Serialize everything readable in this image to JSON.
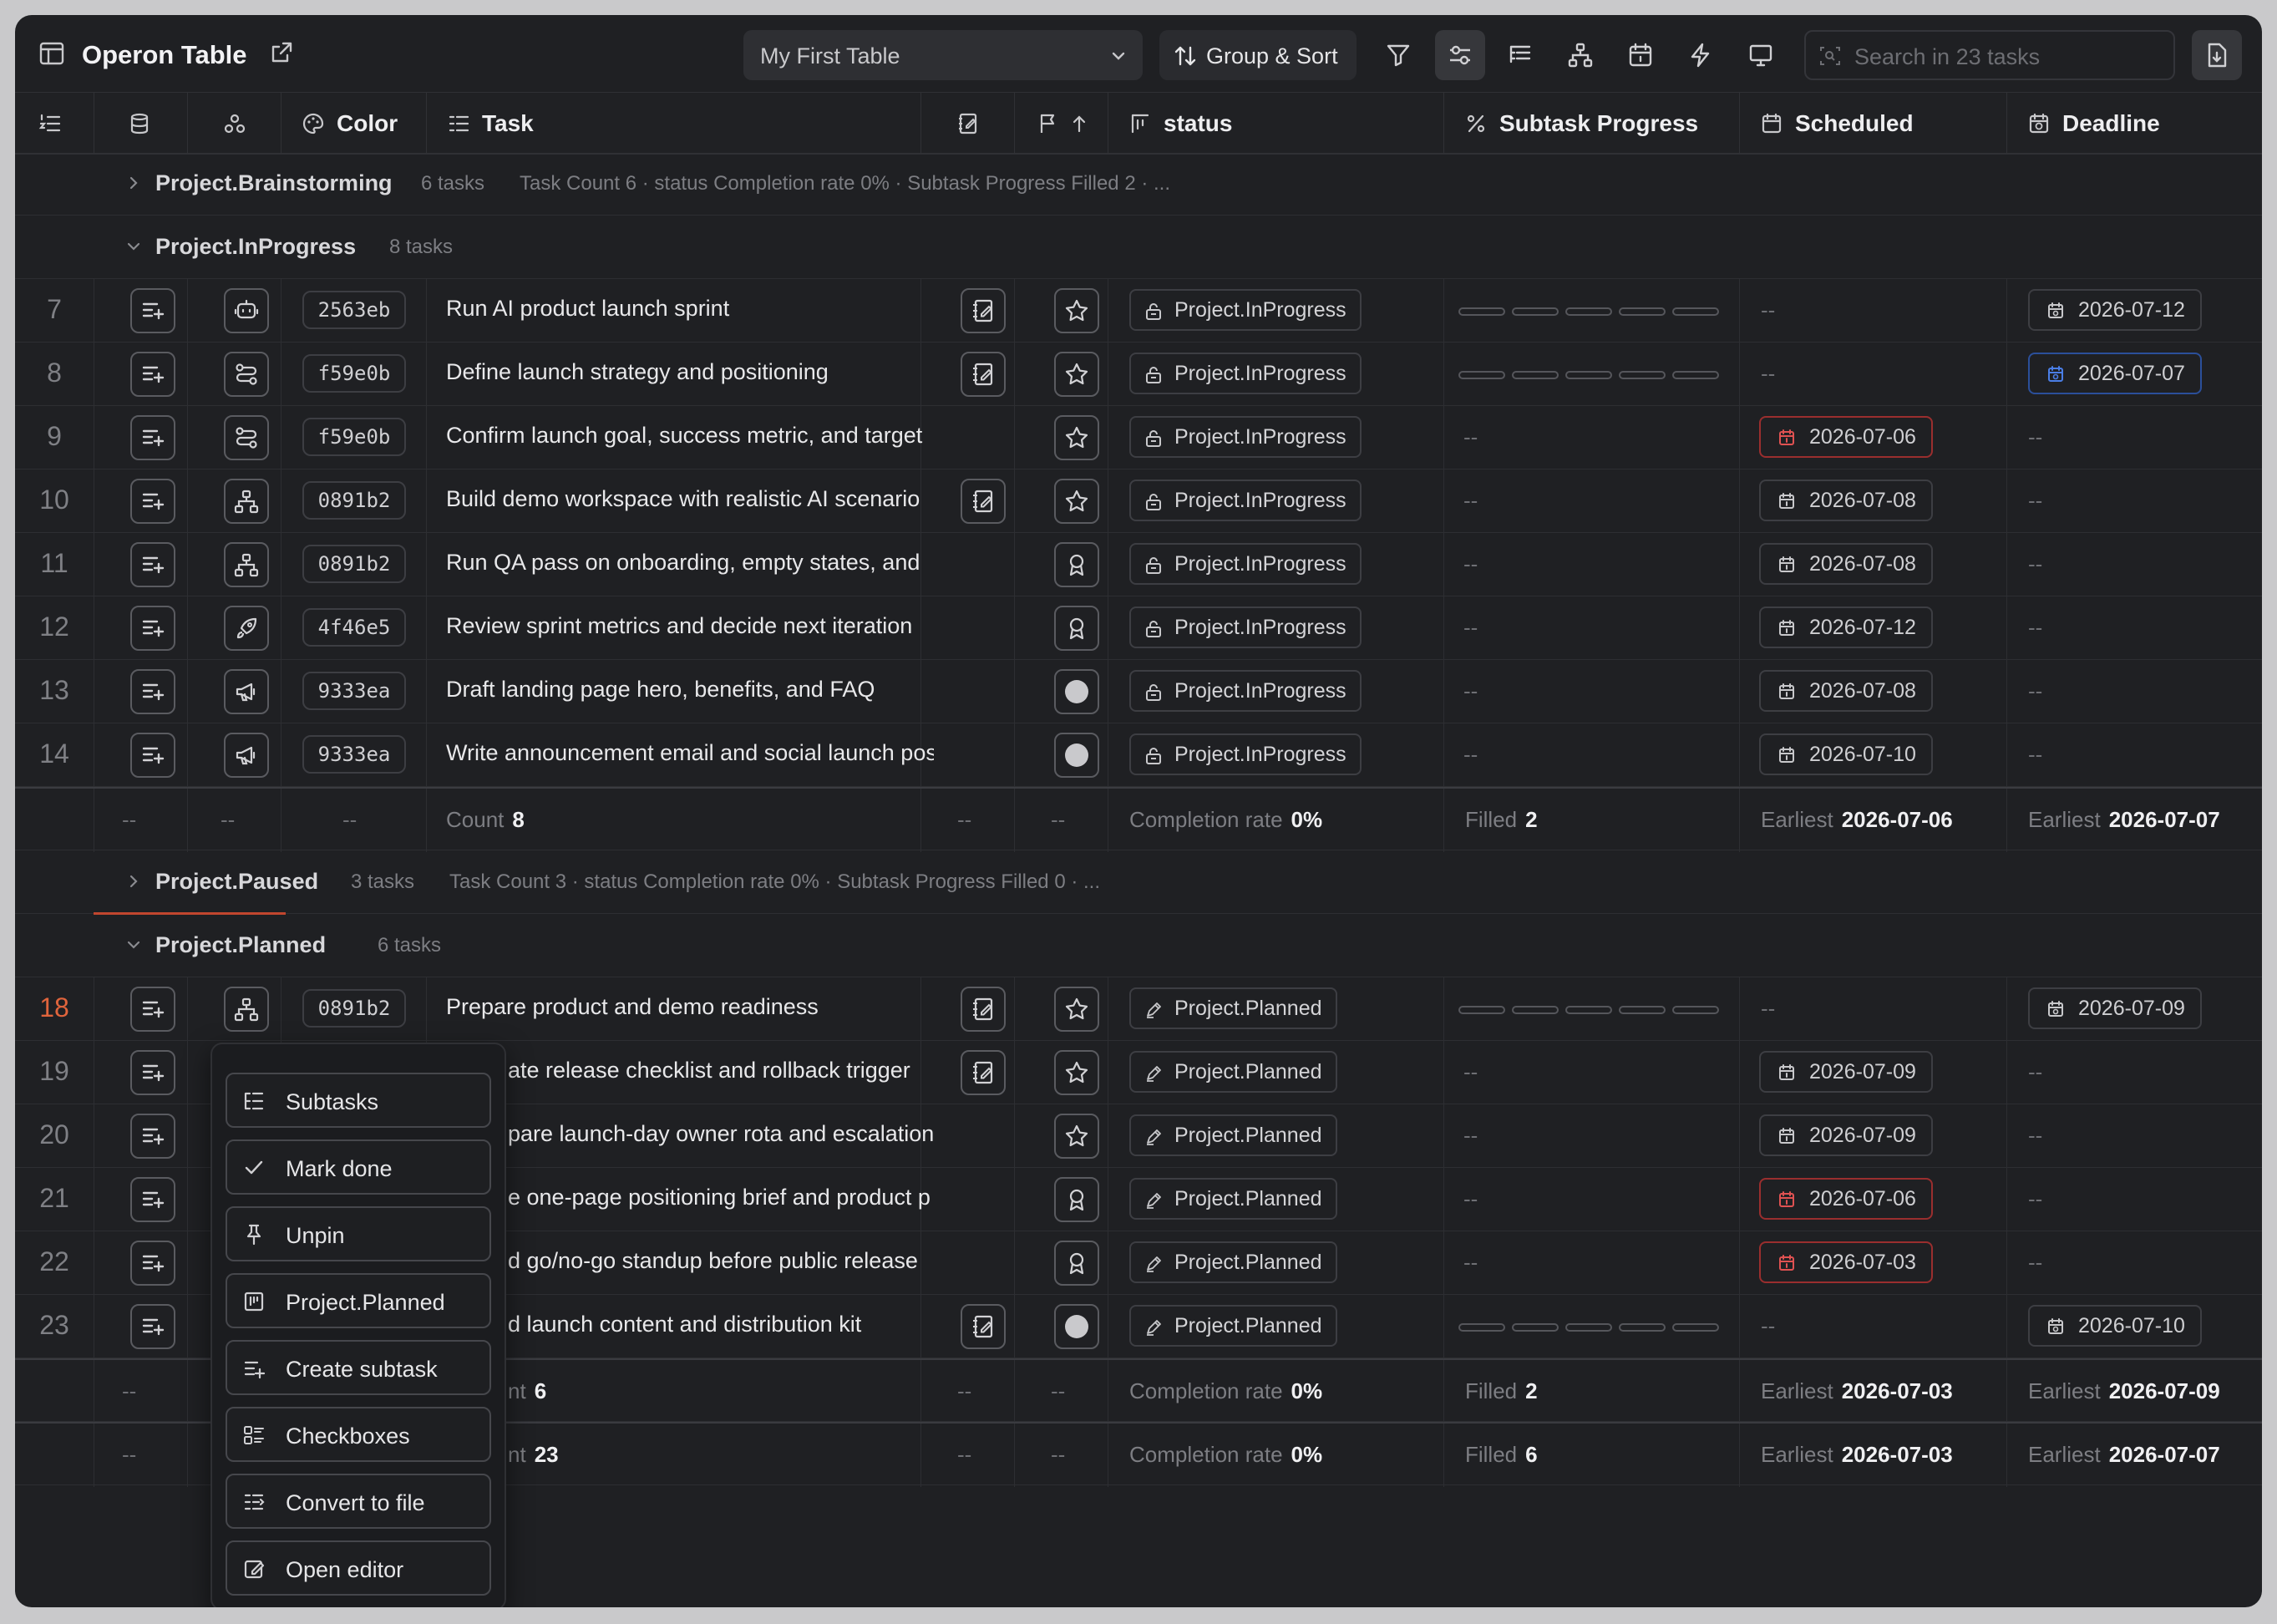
{
  "window": {
    "title": "Operon Table",
    "table_select": "My First Table",
    "group_sort_label": "Group & Sort",
    "search_placeholder": "Search in 23 tasks"
  },
  "columns": {
    "color": "Color",
    "task": "Task",
    "status": "status",
    "subtask_progress": "Subtask Progress",
    "scheduled": "Scheduled",
    "deadline": "Deadline"
  },
  "groups": [
    {
      "name": "Project.Brainstorming",
      "count": "6 tasks",
      "summary": "Task Count 6 · status Completion rate 0% · Subtask Progress Filled 2 · ..."
    },
    {
      "name": "Project.InProgress",
      "count": "8 tasks"
    },
    {
      "name": "Project.Paused",
      "count": "3 tasks",
      "summary": "Task Count 3 · status Completion rate 0% · Subtask Progress Filled 0 · ..."
    },
    {
      "name": "Project.Planned",
      "count": "6 tasks"
    }
  ],
  "rows_inprogress": [
    {
      "num": "7",
      "hash": "2563eb",
      "task": "Run AI product launch sprint",
      "status": "Project.InProgress",
      "scheduled": "--",
      "deadline": "2026-07-12"
    },
    {
      "num": "8",
      "hash": "f59e0b",
      "task": "Define launch strategy and positioning",
      "status": "Project.InProgress",
      "scheduled": "--",
      "deadline": "2026-07-07"
    },
    {
      "num": "9",
      "hash": "f59e0b",
      "task": "Confirm launch goal, success metric, and target",
      "status": "Project.InProgress",
      "scheduled": "2026-07-06",
      "deadline": "--"
    },
    {
      "num": "10",
      "hash": "0891b2",
      "task": "Build demo workspace with realistic AI scenario",
      "status": "Project.InProgress",
      "scheduled": "2026-07-08",
      "deadline": "--"
    },
    {
      "num": "11",
      "hash": "0891b2",
      "task": "Run QA pass on onboarding, empty states, and",
      "status": "Project.InProgress",
      "scheduled": "2026-07-08",
      "deadline": "--"
    },
    {
      "num": "12",
      "hash": "4f46e5",
      "task": "Review sprint metrics and decide next iteration",
      "status": "Project.InProgress",
      "scheduled": "2026-07-12",
      "deadline": "--"
    },
    {
      "num": "13",
      "hash": "9333ea",
      "task": "Draft landing page hero, benefits, and FAQ",
      "status": "Project.InProgress",
      "scheduled": "2026-07-08",
      "deadline": "--"
    },
    {
      "num": "14",
      "hash": "9333ea",
      "task": "Write announcement email and social launch posts",
      "status": "Project.InProgress",
      "scheduled": "2026-07-10",
      "deadline": "--"
    }
  ],
  "summary_inprogress": {
    "count_label": "Count",
    "count": "8",
    "completion_label": "Completion rate",
    "completion": "0%",
    "filled_label": "Filled",
    "filled": "2",
    "earliest_label": "Earliest",
    "scheduled": "2026-07-06",
    "deadline": "2026-07-07"
  },
  "rows_planned": [
    {
      "num": "18",
      "hash": "0891b2",
      "task": "Prepare product and demo readiness",
      "status": "Project.Planned",
      "scheduled": "--",
      "deadline": "2026-07-09"
    },
    {
      "num": "19",
      "task": "ate release checklist and rollback trigger",
      "status": "Project.Planned",
      "scheduled": "2026-07-09",
      "deadline": "--"
    },
    {
      "num": "20",
      "task": "pare launch-day owner rota and escalation",
      "status": "Project.Planned",
      "scheduled": "2026-07-09",
      "deadline": "--"
    },
    {
      "num": "21",
      "task": "e one-page positioning brief and product p",
      "status": "Project.Planned",
      "scheduled": "2026-07-06",
      "deadline": "--"
    },
    {
      "num": "22",
      "task": "d go/no-go standup before public release",
      "status": "Project.Planned",
      "scheduled": "2026-07-03",
      "deadline": "--"
    },
    {
      "num": "23",
      "task": "d launch content and distribution kit",
      "status": "Project.Planned",
      "scheduled": "--",
      "deadline": "2026-07-10"
    }
  ],
  "summary_planned": {
    "count_label": "nt",
    "count": "6",
    "completion_label": "Completion rate",
    "completion": "0%",
    "filled_label": "Filled",
    "filled": "2",
    "earliest_label": "Earliest",
    "scheduled": "2026-07-03",
    "deadline": "2026-07-09"
  },
  "summary_total": {
    "count_label": "nt",
    "count": "23",
    "completion_label": "Completion rate",
    "completion": "0%",
    "filled_label": "Filled",
    "filled": "6",
    "earliest_label": "Earliest",
    "scheduled": "2026-07-03",
    "deadline": "2026-07-07"
  },
  "empty": "--",
  "context_menu": [
    "Subtasks",
    "Mark done",
    "Unpin",
    "Project.Planned",
    "Create subtask",
    "Checkboxes",
    "Convert to file",
    "Open editor"
  ],
  "colors": {
    "accent_red": "#e0643c",
    "danger_border": "#9a2e2e",
    "info_border": "#2b4f9a"
  }
}
